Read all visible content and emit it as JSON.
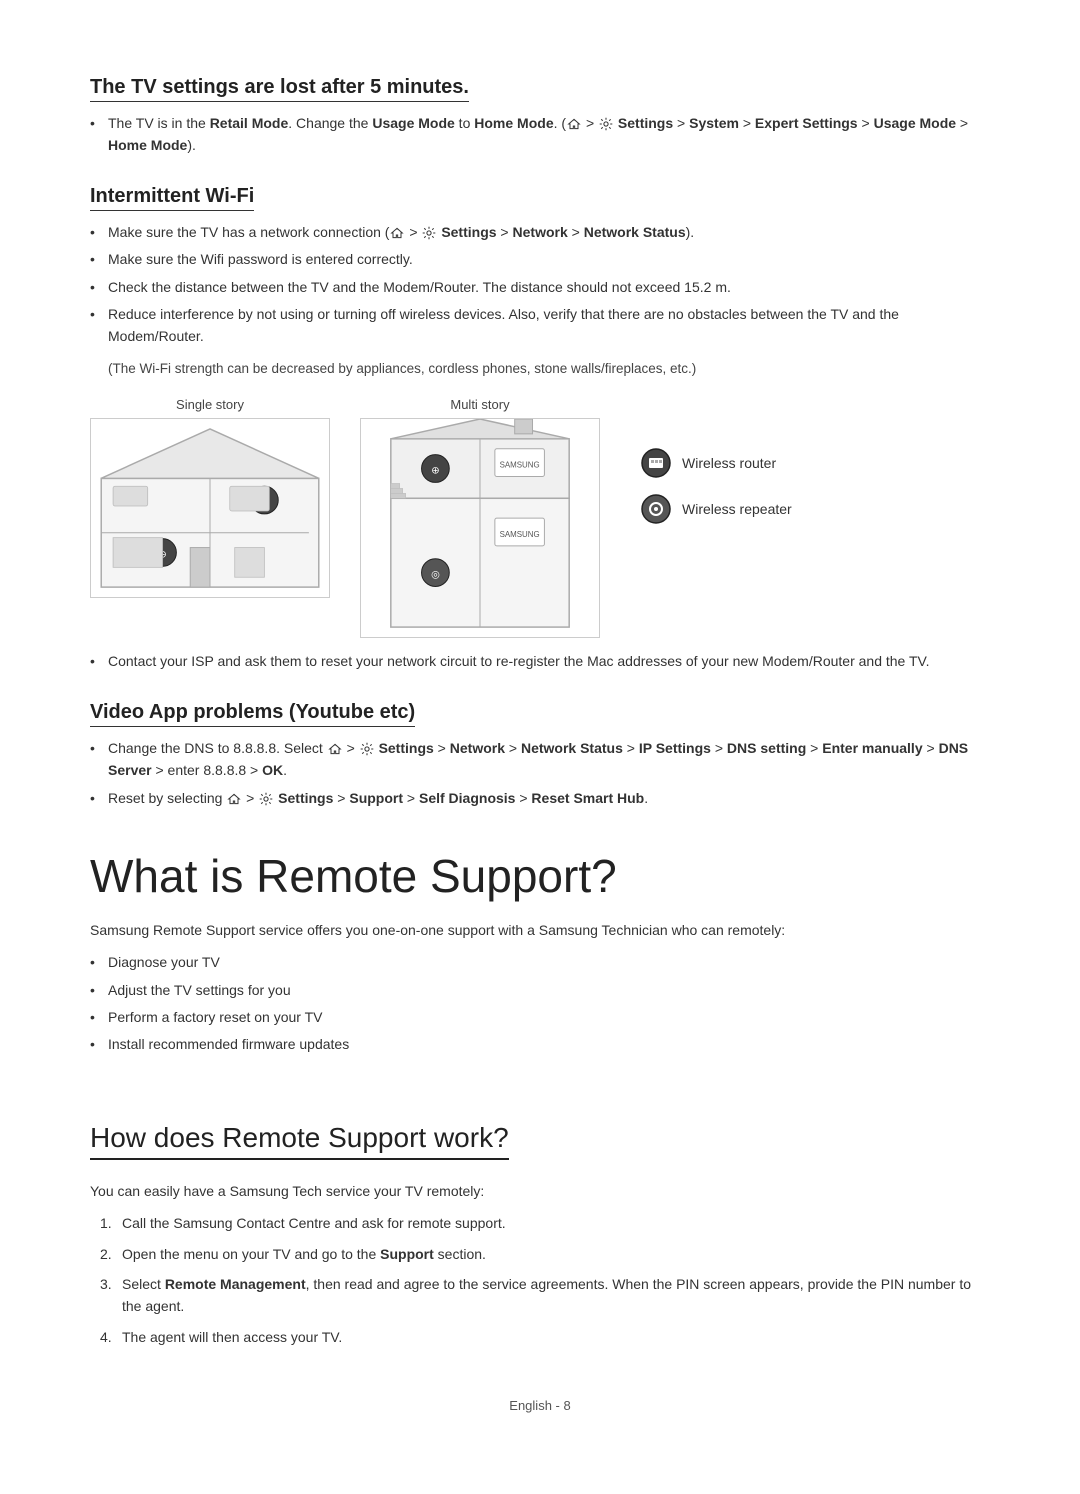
{
  "sections": {
    "tv_settings": {
      "title": "The TV settings are lost after 5 minutes.",
      "bullets": [
        {
          "text": "The TV is in the ",
          "bold_parts": [
            "Retail Mode",
            "Usage Mode",
            "Home Mode",
            "Settings",
            "System",
            "Expert Settings",
            "Usage Mode",
            "Home Mode"
          ],
          "full": "The TV is in the Retail Mode. Change the Usage Mode to Home Mode. (⌂ > ⚙ Settings > System > Expert Settings > Usage Mode > Home Mode)."
        }
      ]
    },
    "intermittent_wifi": {
      "title": "Intermittent Wi-Fi",
      "bullets": [
        "Make sure the TV has a network connection (⌂ > ⚙ Settings > Network > Network Status).",
        "Make sure the Wifi password is entered correctly.",
        "Check the distance between the TV and the Modem/Router. The distance should not exceed 15.2 m.",
        "Reduce interference by not using or turning off wireless devices. Also, verify that there are no obstacles between the TV and the Modem/Router."
      ],
      "note": "(The Wi-Fi strength can be decreased by appliances, cordless phones, stone walls/fireplaces, etc.)",
      "diagram": {
        "single_story_label": "Single story",
        "multi_story_label": "Multi story"
      },
      "post_bullet": "Contact your ISP and ask them to reset your network circuit to re-register the Mac addresses of your new Modem/Router and the TV."
    },
    "video_app": {
      "title": "Video App problems (Youtube etc)",
      "bullets": [
        "Change the DNS to 8.8.8.8. Select ⌂ > ⚙ Settings > Network > Network Status > IP Settings > DNS setting > Enter manually > DNS Server > enter 8.8.8.8 > OK.",
        "Reset by selecting ⌂ > ⚙ Settings > Support > Self Diagnosis > Reset Smart Hub."
      ]
    },
    "remote_support": {
      "title": "What is Remote Support?",
      "intro": "Samsung Remote Support service offers you one-on-one support with a Samsung Technician who can remotely:",
      "bullets": [
        "Diagnose your TV",
        "Adjust the TV settings for you",
        "Perform a factory reset on your TV",
        "Install recommended firmware updates"
      ]
    },
    "how_remote_support": {
      "title": "How does Remote Support work?",
      "intro": "You can easily have a Samsung Tech service your TV remotely:",
      "steps": [
        "Call the Samsung Contact Centre and ask for remote support.",
        "Open the menu on your TV and go to the Support section.",
        "Select Remote Management, then read and agree to the service agreements. When the PIN screen appears, provide the PIN number to the agent.",
        "The agent will then access your TV."
      ]
    }
  },
  "legend": {
    "wireless_router": "Wireless router",
    "wireless_repeater": "Wireless repeater"
  },
  "footer": {
    "text": "English - 8"
  }
}
